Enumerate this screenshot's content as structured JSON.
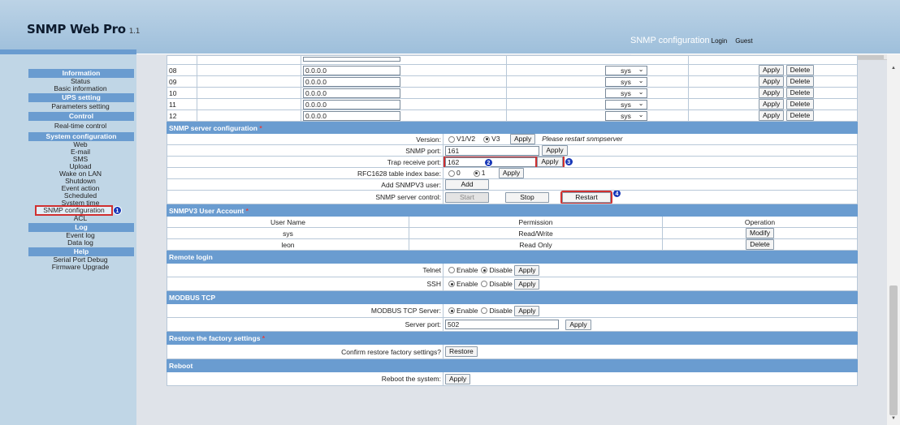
{
  "header": {
    "app_title": "SNMP Web Pro",
    "version": "1.1",
    "page_title": "SNMP configuration",
    "login": "Login",
    "guest": "Guest"
  },
  "menu": {
    "sections": [
      {
        "title": "Information",
        "items": [
          "Status",
          "Basic information"
        ]
      },
      {
        "title": "UPS setting",
        "items": [
          "Parameters setting"
        ]
      },
      {
        "title": "Control",
        "items": [
          "Real-time control"
        ]
      },
      {
        "title": "System configuration",
        "items": [
          "Web",
          "E-mail",
          "SMS",
          "Upload",
          "Wake on LAN",
          "Shutdown",
          "Event action",
          "Scheduled",
          "System time",
          "SNMP configuration",
          "ACL"
        ]
      },
      {
        "title": "Log",
        "items": [
          "Event log",
          "Data log"
        ]
      },
      {
        "title": "Help",
        "items": [
          "Serial Port Debug",
          "Firmware Upgrade"
        ]
      }
    ],
    "selected": "SNMP configuration"
  },
  "badges": [
    "1",
    "2",
    "3",
    "4"
  ],
  "trap_table": {
    "rows": [
      {
        "idx": "08",
        "ip": "0.0.0.0",
        "community": "sys"
      },
      {
        "idx": "09",
        "ip": "0.0.0.0",
        "community": "sys"
      },
      {
        "idx": "10",
        "ip": "0.0.0.0",
        "community": "sys"
      },
      {
        "idx": "11",
        "ip": "0.0.0.0",
        "community": "sys"
      },
      {
        "idx": "12",
        "ip": "0.0.0.0",
        "community": "sys"
      }
    ],
    "apply_label": "Apply",
    "delete_label": "Delete"
  },
  "snmp_server": {
    "title": "SNMP server configuration",
    "asterisk": "*",
    "version_label": "Version:",
    "v1v2": "V1/V2",
    "v3": "V3",
    "apply": "Apply",
    "restart_note": "Please restart snmpserver",
    "snmp_port_label": "SNMP port:",
    "snmp_port": "161",
    "trap_port_label": "Trap receive port:",
    "trap_port": "162",
    "rfc_label": "RFC1628 table index base:",
    "rfc0": "0",
    "rfc1": "1",
    "add_user_label": "Add SNMPV3 user:",
    "add": "Add",
    "control_label": "SNMP server control:",
    "start": "Start",
    "stop": "Stop",
    "restart": "Restart"
  },
  "v3_accounts": {
    "title": "SNMPV3 User Account",
    "asterisk": "*",
    "headers": [
      "User Name",
      "Permission",
      "Operation"
    ],
    "rows": [
      {
        "user": "sys",
        "permission": "Read/Write",
        "op": "Modify"
      },
      {
        "user": "leon",
        "permission": "Read Only",
        "op": "Delete"
      }
    ]
  },
  "remote_login": {
    "title": "Remote login",
    "telnet_label": "Telnet",
    "ssh_label": "SSH",
    "enable": "Enable",
    "disable": "Disable",
    "apply": "Apply"
  },
  "modbus": {
    "title": "MODBUS TCP",
    "server_label": "MODBUS TCP Server:",
    "enable": "Enable",
    "disable": "Disable",
    "apply": "Apply",
    "port_label": "Server port:",
    "port": "502"
  },
  "restore": {
    "title": "Restore the factory settings",
    "asterisk": "*",
    "label": "Confirm restore factory settings?",
    "button": "Restore"
  },
  "reboot": {
    "title": "Reboot",
    "label": "Reboot the system:",
    "button": "Apply"
  }
}
